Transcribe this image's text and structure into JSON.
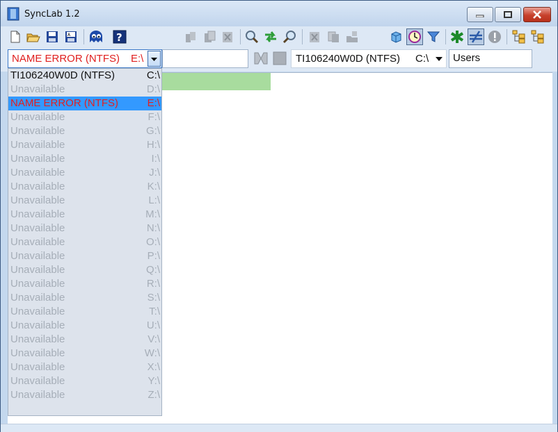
{
  "app": {
    "title": "SyncLab 1.2"
  },
  "left_drive": {
    "label": "NAME ERROR (NTFS)",
    "drive": "E:\\",
    "path": ""
  },
  "right_drive": {
    "label": "TI106240W0D (NTFS)",
    "drive": "C:\\",
    "path": "Users"
  },
  "drive_list": [
    {
      "label": "TI106240W0D (NTFS)",
      "drive": "C:\\",
      "state": "ok"
    },
    {
      "label": "Unavailable",
      "drive": "D:\\",
      "state": "na"
    },
    {
      "label": "NAME ERROR (NTFS)",
      "drive": "E:\\",
      "state": "sel"
    },
    {
      "label": "Unavailable",
      "drive": "F:\\",
      "state": "na"
    },
    {
      "label": "Unavailable",
      "drive": "G:\\",
      "state": "na"
    },
    {
      "label": "Unavailable",
      "drive": "H:\\",
      "state": "na"
    },
    {
      "label": "Unavailable",
      "drive": "I:\\",
      "state": "na"
    },
    {
      "label": "Unavailable",
      "drive": "J:\\",
      "state": "na"
    },
    {
      "label": "Unavailable",
      "drive": "K:\\",
      "state": "na"
    },
    {
      "label": "Unavailable",
      "drive": "L:\\",
      "state": "na"
    },
    {
      "label": "Unavailable",
      "drive": "M:\\",
      "state": "na"
    },
    {
      "label": "Unavailable",
      "drive": "N:\\",
      "state": "na"
    },
    {
      "label": "Unavailable",
      "drive": "O:\\",
      "state": "na"
    },
    {
      "label": "Unavailable",
      "drive": "P:\\",
      "state": "na"
    },
    {
      "label": "Unavailable",
      "drive": "Q:\\",
      "state": "na"
    },
    {
      "label": "Unavailable",
      "drive": "R:\\",
      "state": "na"
    },
    {
      "label": "Unavailable",
      "drive": "S:\\",
      "state": "na"
    },
    {
      "label": "Unavailable",
      "drive": "T:\\",
      "state": "na"
    },
    {
      "label": "Unavailable",
      "drive": "U:\\",
      "state": "na"
    },
    {
      "label": "Unavailable",
      "drive": "V:\\",
      "state": "na"
    },
    {
      "label": "Unavailable",
      "drive": "W:\\",
      "state": "na"
    },
    {
      "label": "Unavailable",
      "drive": "X:\\",
      "state": "na"
    },
    {
      "label": "Unavailable",
      "drive": "Y:\\",
      "state": "na"
    },
    {
      "label": "Unavailable",
      "drive": "Z:\\",
      "state": "na"
    }
  ],
  "toolbar_icons": [
    "new-file-icon",
    "open-folder-icon",
    "save-icon",
    "save-as-icon",
    "ghost-icon",
    "help-icon",
    "copy-left-icon",
    "copy-icon",
    "delete-icon",
    "search-icon",
    "sync-arrows-icon",
    "find-icon",
    "delete-left-icon",
    "copy-right-icon",
    "move-right-icon",
    "cube-icon",
    "clock-icon",
    "filter-icon",
    "asterisk-icon",
    "not-equal-icon",
    "warning-icon",
    "tree-left-icon",
    "tree-right-icon"
  ],
  "colors": {
    "error_text": "#e02020",
    "selection": "#3399ff",
    "green_bar": "#a8dc9e"
  }
}
